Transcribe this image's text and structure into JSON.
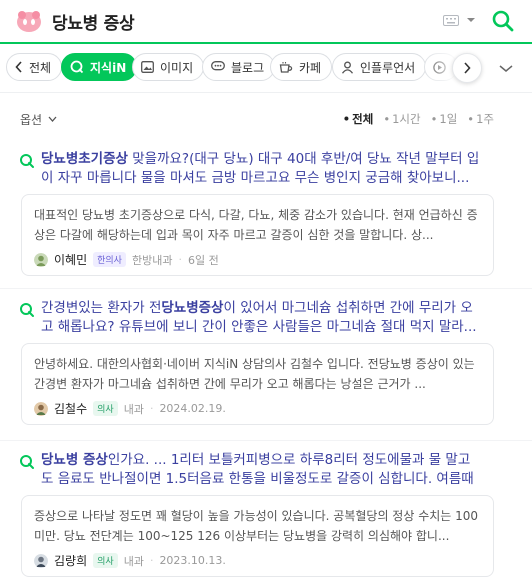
{
  "header": {
    "query": "당뇨병 증상",
    "logo_icon": "pink-face-logo-icon",
    "keyboard_icon": "keyboard-icon",
    "search_icon": "search-icon",
    "accent_color": "#03c75a"
  },
  "tabs": {
    "items": [
      {
        "label": "전체",
        "icon": "chevron-left-icon"
      },
      {
        "label": "지식iN",
        "icon": "kin-q-icon",
        "active": true
      },
      {
        "label": "이미지",
        "icon": "image-icon"
      },
      {
        "label": "블로그",
        "icon": "chat-bubble-icon"
      },
      {
        "label": "카페",
        "icon": "cup-icon"
      },
      {
        "label": "인플루언서",
        "icon": "person-icon"
      },
      {
        "label": "",
        "icon": "play-icon"
      }
    ]
  },
  "options": {
    "label": "옵션",
    "filters": [
      {
        "label": "전체",
        "active": true
      },
      {
        "label": "1시간",
        "active": false
      },
      {
        "label": "1일",
        "active": false
      },
      {
        "label": "1주",
        "active": false
      }
    ]
  },
  "results": [
    {
      "title_parts": [
        {
          "text": "당뇨병초기증상",
          "bold": true
        },
        {
          "text": " 맞을까요?(대구 당뇨) 대구 40대 후반/여 당뇨 작년 말부터 입이 자꾸 마릅니다 물을 마셔도 금방 마르고요 무슨 병인지 궁금해 찾아보니...",
          "bold": false
        }
      ],
      "answer": "대표적인 당뇨병 초기증상으로 다식, 다갈, 다뇨, 체중 감소가 있습니다. 현재 언급하신 증상은 다갈에 해당하는데 입과 목이 자주 마르고 갈증이 심한 것을 말합니다. 상...",
      "author": "이혜민",
      "badge": "한의사",
      "dept": "한방내과",
      "date": "6일 전"
    },
    {
      "title_parts": [
        {
          "text": "간경변있는 환자가 전",
          "bold": false
        },
        {
          "text": "당뇨병증상",
          "bold": true
        },
        {
          "text": "이 있어서 마그네슘 섭취하면 간에 무리가 오고 해롭나요? 유튜브에 보니 간이 안좋은 사람들은 마그네슘 절대 먹지 말라...",
          "bold": false
        }
      ],
      "answer": "안녕하세요. 대한의사협회·네이버 지식iN 상담의사 김철수 입니다. 전당뇨병 증상이 있는 간경변 환자가 마그네슘 섭취하면 간에 무리가 오고 해롭다는 낭설은 근거가 ...",
      "author": "김철수",
      "badge": "의사",
      "dept": "내과",
      "date": "2024.02.19."
    },
    {
      "title_parts": [
        {
          "text": "당뇨병 증상",
          "bold": true
        },
        {
          "text": "인가요. ... 1리터 보틀커피병으로 하루8리터 정도에물과 물 말고도 음료도 반나절이면 1.5터음료 한통을 비울정도로 갈증이 심합니다. 여름때보...",
          "bold": false
        }
      ],
      "answer": "증상으로 나타날 정도면 꽤 혈당이 높을 가능성이 있습니다. 공복혈당의 정상 수치는 100미만. 당뇨 전단계는 100~125 126 이상부터는 당뇨병을 강력히 의심해야 합니...",
      "author": "김량희",
      "badge": "의사",
      "dept": "내과",
      "date": "2023.10.13."
    }
  ]
}
